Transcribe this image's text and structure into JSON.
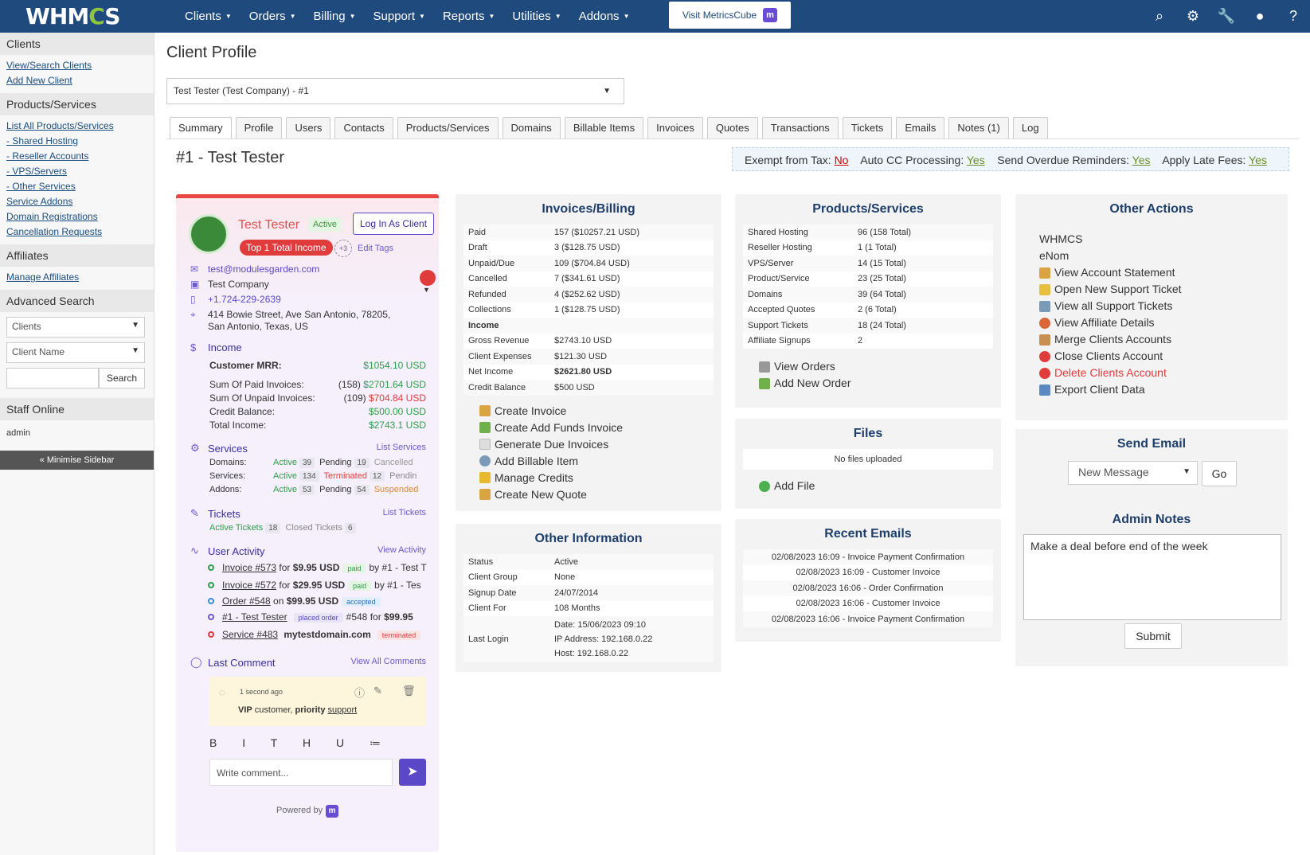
{
  "nav": {
    "logo": "WHMCS",
    "menu": [
      "Clients",
      "Orders",
      "Billing",
      "Support",
      "Reports",
      "Utilities",
      "Addons"
    ],
    "visit": "Visit MetricsCube",
    "visit_badge": "m"
  },
  "sidebar": {
    "clients_h": "Clients",
    "clients_links": [
      "View/Search Clients",
      "Add New Client"
    ],
    "ps_h": "Products/Services",
    "ps_links": [
      "List All Products/Services",
      "- Shared Hosting",
      "- Reseller Accounts",
      "- VPS/Servers",
      "- Other Services",
      "Service Addons",
      "Domain Registrations",
      "Cancellation Requests"
    ],
    "aff_h": "Affiliates",
    "aff_links": [
      "Manage Affiliates"
    ],
    "adv_h": "Advanced Search",
    "sel1": "Clients",
    "sel2": "Client Name",
    "search_btn": "Search",
    "staff_h": "Staff Online",
    "staff": "admin",
    "minimise": "« Minimise Sidebar"
  },
  "page": {
    "title": "Client Profile",
    "client_select": "Test Tester (Test Company) - #1",
    "tabs": [
      "Summary",
      "Profile",
      "Users",
      "Contacts",
      "Products/Services",
      "Domains",
      "Billable Items",
      "Invoices",
      "Quotes",
      "Transactions",
      "Tickets",
      "Emails",
      "Notes (1)",
      "Log"
    ],
    "heading": "#1 - Test Tester",
    "flags": {
      "tax_l": "Exempt from Tax:",
      "tax_v": "No",
      "cc_l": "Auto CC Processing:",
      "cc_v": "Yes",
      "od_l": "Send Overdue Reminders:",
      "od_v": "Yes",
      "late_l": "Apply Late Fees:",
      "late_v": "Yes"
    }
  },
  "card": {
    "name": "Test Tester",
    "status": "Active",
    "login": "Log In As Client",
    "top_income": "Top 1 Total Income",
    "plus": "+3",
    "edit_tags": "Edit Tags",
    "email": "test@modulesgarden.com",
    "company": "Test Company",
    "phone": "+1.724-229-2639",
    "address": "414 Bowie Street, Ave San Antonio, 78205, San Antonio, Texas, US",
    "income_h": "Income",
    "mrr_l": "Customer MRR:",
    "mrr_v": "$1054.10 USD",
    "paid_l": "Sum Of Paid Invoices:",
    "paid_n": "(158)",
    "paid_v": "$2701.64 USD",
    "unpaid_l": "Sum Of Unpaid Invoices:",
    "unpaid_n": "(109)",
    "unpaid_v": "$704.84 USD",
    "credit_l": "Credit Balance:",
    "credit_v": "$500.00 USD",
    "total_l": "Total Income:",
    "total_v": "$2743.1 USD",
    "services_h": "Services",
    "list_services": "List Services",
    "dom_l": "Domains:",
    "dom_a": "Active",
    "dom_an": "39",
    "dom_p": "Pending",
    "dom_pn": "19",
    "dom_c": "Cancelled",
    "svc_l": "Services:",
    "svc_a": "Active",
    "svc_an": "134",
    "svc_t": "Terminated",
    "svc_tn": "12",
    "svc_p": "Pendin",
    "add_l": "Addons:",
    "add_a": "Active",
    "add_an": "53",
    "add_p": "Pending",
    "add_pn": "54",
    "add_s": "Suspended",
    "tickets_h": "Tickets",
    "list_tickets": "List Tickets",
    "t_active": "Active Tickets",
    "t_active_n": "18",
    "t_closed": "Closed Tickets",
    "t_closed_n": "6",
    "activity_h": "User Activity",
    "view_activity": "View Activity",
    "act1": [
      "Invoice #573",
      "for",
      "$9.95 USD",
      "paid",
      "by #1 - Test T"
    ],
    "act2": [
      "Invoice #572",
      "for",
      "$29.95 USD",
      "paid",
      "by #1 - Tes"
    ],
    "act3": [
      "Order #548",
      "on",
      "$99.95 USD",
      "accepted"
    ],
    "act4": [
      "#1 - Test Tester",
      "placed order",
      "#548",
      "for",
      "$99.95"
    ],
    "act5": [
      "Service #483",
      "mytestdomain.com",
      "terminated"
    ],
    "comment_h": "Last Comment",
    "view_comments": "View All Comments",
    "comment_time": "1 second ago",
    "comment_a": "VIP",
    "comment_b": "customer,",
    "comment_c": "priority",
    "comment_d": "support",
    "editor": "B I T H U ≔",
    "write": "Write comment...",
    "powered": "Powered by",
    "powered_badge": "m"
  },
  "invoices": {
    "h": "Invoices/Billing",
    "rows": [
      [
        "Paid",
        "157 ($10257.21 USD)"
      ],
      [
        "Draft",
        "3 ($128.75 USD)"
      ],
      [
        "Unpaid/Due",
        "109 ($704.84 USD)"
      ],
      [
        "Cancelled",
        "7 ($341.61 USD)"
      ],
      [
        "Refunded",
        "4 ($252.62 USD)"
      ],
      [
        "Collections",
        "1 ($128.75 USD)"
      ],
      [
        "Income",
        ""
      ],
      [
        "Gross Revenue",
        "$2743.10 USD"
      ],
      [
        "Client Expenses",
        "$121.30 USD"
      ],
      [
        "Net Income",
        "$2621.80 USD"
      ],
      [
        "Credit Balance",
        "$500 USD"
      ]
    ],
    "actions": [
      "Create Invoice",
      "Create Add Funds Invoice",
      "Generate Due Invoices",
      "Add Billable Item",
      "Manage Credits",
      "Create New Quote"
    ]
  },
  "other_info": {
    "h": "Other Information",
    "rows": [
      [
        "Status",
        "Active"
      ],
      [
        "Client Group",
        "None"
      ],
      [
        "Signup Date",
        "24/07/2014"
      ],
      [
        "Client For",
        "108 Months"
      ]
    ],
    "last_login_l": "Last Login",
    "last_login": [
      "Date: 15/06/2023 09:10",
      "IP Address: 192.168.0.22",
      "Host: 192.168.0.22"
    ]
  },
  "products": {
    "h": "Products/Services",
    "rows": [
      [
        "Shared Hosting",
        "96 (158 Total)"
      ],
      [
        "Reseller Hosting",
        "1 (1 Total)"
      ],
      [
        "VPS/Server",
        "14 (15 Total)"
      ],
      [
        "Product/Service",
        "23 (25 Total)"
      ],
      [
        "Domains",
        "39 (64 Total)"
      ],
      [
        "Accepted Quotes",
        "2 (6 Total)"
      ],
      [
        "Support Tickets",
        "18 (24 Total)"
      ],
      [
        "Affiliate Signups",
        "2"
      ]
    ],
    "actions": [
      "View Orders",
      "Add New Order"
    ]
  },
  "files": {
    "h": "Files",
    "empty": "No files uploaded",
    "add": "Add File"
  },
  "emails": {
    "h": "Recent Emails",
    "rows": [
      "02/08/2023 16:09 - Invoice Payment Confirmation",
      "02/08/2023 16:09 - Customer Invoice",
      "02/08/2023 16:06 - Order Confirmation",
      "02/08/2023 16:06 - Customer Invoice",
      "02/08/2023 16:06 - Invoice Payment Confirmation"
    ]
  },
  "other_actions": {
    "h": "Other Actions",
    "plain": [
      "WHMCS",
      "eNom"
    ],
    "actions": [
      "View Account Statement",
      "Open New Support Ticket",
      "View all Support Tickets",
      "View Affiliate Details",
      "Merge Clients Accounts",
      "Close Clients Account",
      "Delete Clients Account",
      "Export Client Data"
    ]
  },
  "send_email": {
    "h": "Send Email",
    "select": "New Message",
    "go": "Go"
  },
  "admin_notes": {
    "h": "Admin Notes",
    "text": "Make a deal before end of the week",
    "submit": "Submit"
  }
}
